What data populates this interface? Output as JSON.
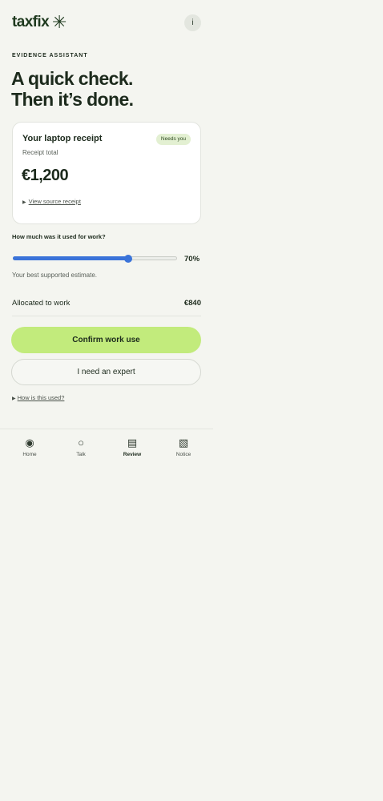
{
  "header": {
    "logo_text": "taxfix",
    "logo_symbol": "✳",
    "info_icon": "i"
  },
  "eyebrow": "EVIDENCE ASSISTANT",
  "headline": {
    "line1": "A quick check.",
    "line2": "Then it’s done."
  },
  "receipt_card": {
    "title": "Your laptop receipt",
    "badge": "Needs you",
    "subtitle": "Receipt total",
    "amount": "€1,200",
    "link_arrow": "▶",
    "link_text": "View source receipt"
  },
  "work_use": {
    "question": "How much was it used for work?",
    "value_percent": 70,
    "value_label": "70%",
    "hint": "Your best supported estimate.",
    "allocated_label": "Allocated to work",
    "allocated_value": "€840"
  },
  "actions": {
    "confirm_label": "Confirm work use",
    "expert_label": "I need an expert"
  },
  "help": {
    "arrow": "▶",
    "text": "How is this used?"
  },
  "nav": {
    "items": [
      {
        "label": "Home",
        "icon": "◉",
        "icon_name": "home-icon",
        "active": false
      },
      {
        "label": "Talk",
        "icon": "○",
        "icon_name": "talk-icon",
        "active": false
      },
      {
        "label": "Review",
        "icon": "▤",
        "icon_name": "review-icon",
        "active": true
      },
      {
        "label": "Notice",
        "icon": "▧",
        "icon_name": "notice-icon",
        "active": false
      }
    ]
  },
  "colors": {
    "background": "#f4f5f0",
    "accent_green": "#c2eb7c",
    "slider_blue": "#3a73d9",
    "text_dark": "#1c2a1c",
    "badge_bg": "#e3f0d2"
  }
}
